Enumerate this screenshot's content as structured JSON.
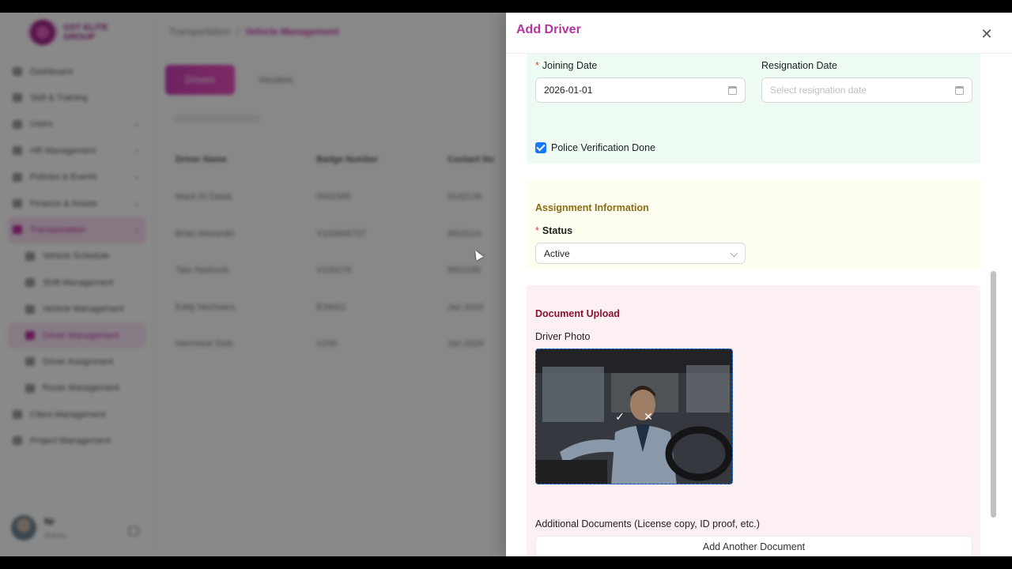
{
  "app": {
    "logo_text": "GST ELITE GROUP",
    "breadcrumb": [
      "Transportation",
      "Vehicle Management"
    ],
    "sidebar": {
      "items": [
        {
          "label": "Dashboard"
        },
        {
          "label": "Skill & Training"
        },
        {
          "label": "Users"
        },
        {
          "label": "HR Management"
        },
        {
          "label": "Policies & Events"
        },
        {
          "label": "Finance & Assets"
        },
        {
          "label": "Transportation"
        },
        {
          "label": "Vehicle Schedule"
        },
        {
          "label": "Shift Management"
        },
        {
          "label": "Vehicle Management"
        },
        {
          "label": "Driver Management"
        },
        {
          "label": "Driver Assignment"
        },
        {
          "label": "Route Management"
        },
        {
          "label": "Client Management"
        },
        {
          "label": "Project Management"
        }
      ]
    },
    "user": {
      "name": "Nr",
      "role": "Admin"
    },
    "tabs": {
      "active": "Drivers",
      "other": "Vendors"
    },
    "table": {
      "headers": [
        "Driver Name",
        "Badge Number",
        "Contact No"
      ],
      "rows": [
        [
          "Mack Di Dasia",
          "0041565",
          "9142136"
        ],
        [
          "Brian Alexandri",
          "V100006707",
          "9823114"
        ],
        [
          "Tala Hashurie",
          "V100276",
          "9921180"
        ],
        [
          "Eddy Nechaars",
          "E39021",
          "Jan 2024"
        ],
        [
          "Hermione Dols",
          "V246",
          "Jan 2024"
        ]
      ]
    }
  },
  "drawer": {
    "title": "Add Driver",
    "joining_date": {
      "label": "Joining Date",
      "value": "2026-01-01"
    },
    "resignation_date": {
      "label": "Resignation Date",
      "placeholder": "Select resignation date"
    },
    "police_verification": {
      "label": "Police Verification Done",
      "checked": true
    },
    "assignment": {
      "title": "Assignment Information",
      "status_label": "Status",
      "status_value": "Active"
    },
    "documents": {
      "title": "Document Upload",
      "photo_label": "Driver Photo",
      "additional_label": "Additional Documents (License copy, ID proof, etc.)",
      "add_button": "Add Another Document"
    }
  },
  "icons": {
    "close": "close-icon",
    "calendar": "calendar-icon",
    "chevron": "chevron-down-icon",
    "confirm": "check-icon",
    "remove": "remove-icon"
  },
  "colors": {
    "accent": "#b235a0",
    "primary": "#1677ff",
    "required": "#e0484e",
    "section_green": "#eefbf2",
    "section_yellow": "#fefef0",
    "section_pink": "#fdf0f2"
  }
}
